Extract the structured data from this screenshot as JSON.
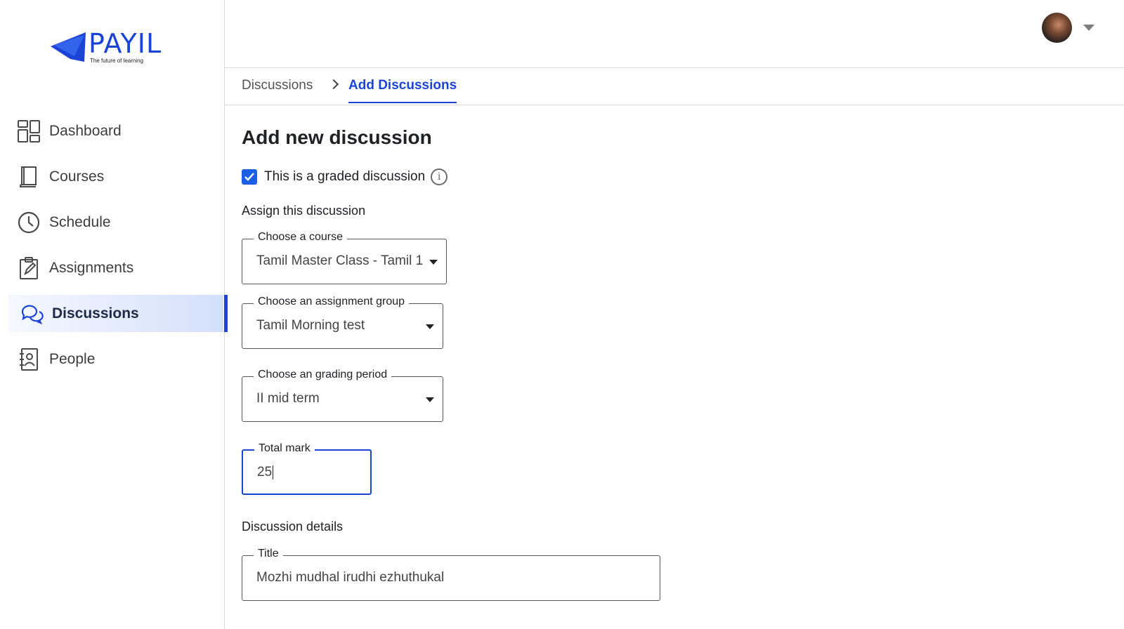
{
  "brand": {
    "name": "PAYIL",
    "tagline": "The future of learning",
    "color": "#1b44d6"
  },
  "sidebar": {
    "items": [
      {
        "label": "Dashboard",
        "icon": "dashboard-icon",
        "active": false
      },
      {
        "label": "Courses",
        "icon": "book-icon",
        "active": false
      },
      {
        "label": "Schedule",
        "icon": "clock-icon",
        "active": false
      },
      {
        "label": "Assignments",
        "icon": "clipboard-icon",
        "active": false
      },
      {
        "label": "Discussions",
        "icon": "chat-bubbles-icon",
        "active": true
      },
      {
        "label": "People",
        "icon": "contact-book-icon",
        "active": false
      }
    ]
  },
  "breadcrumb": {
    "parent": "Discussions",
    "current": "Add Discussions"
  },
  "form": {
    "title": "Add new discussion",
    "graded_checkbox": {
      "label": "This is a graded discussion",
      "checked": true
    },
    "assign_section": "Assign this discussion",
    "course": {
      "label": "Choose a course",
      "value": "Tamil Master Class - Tamil 1"
    },
    "assignment_group": {
      "label": "Choose an assignment group",
      "value": "Tamil Morning test"
    },
    "grading_period": {
      "label": "Choose an grading period",
      "value": "II mid term"
    },
    "total_mark": {
      "label": "Total mark",
      "value": "25"
    },
    "details_section": "Discussion details",
    "discussion_title": {
      "label": "Title",
      "value": "Mozhi mudhal irudhi ezhuthukal"
    }
  }
}
